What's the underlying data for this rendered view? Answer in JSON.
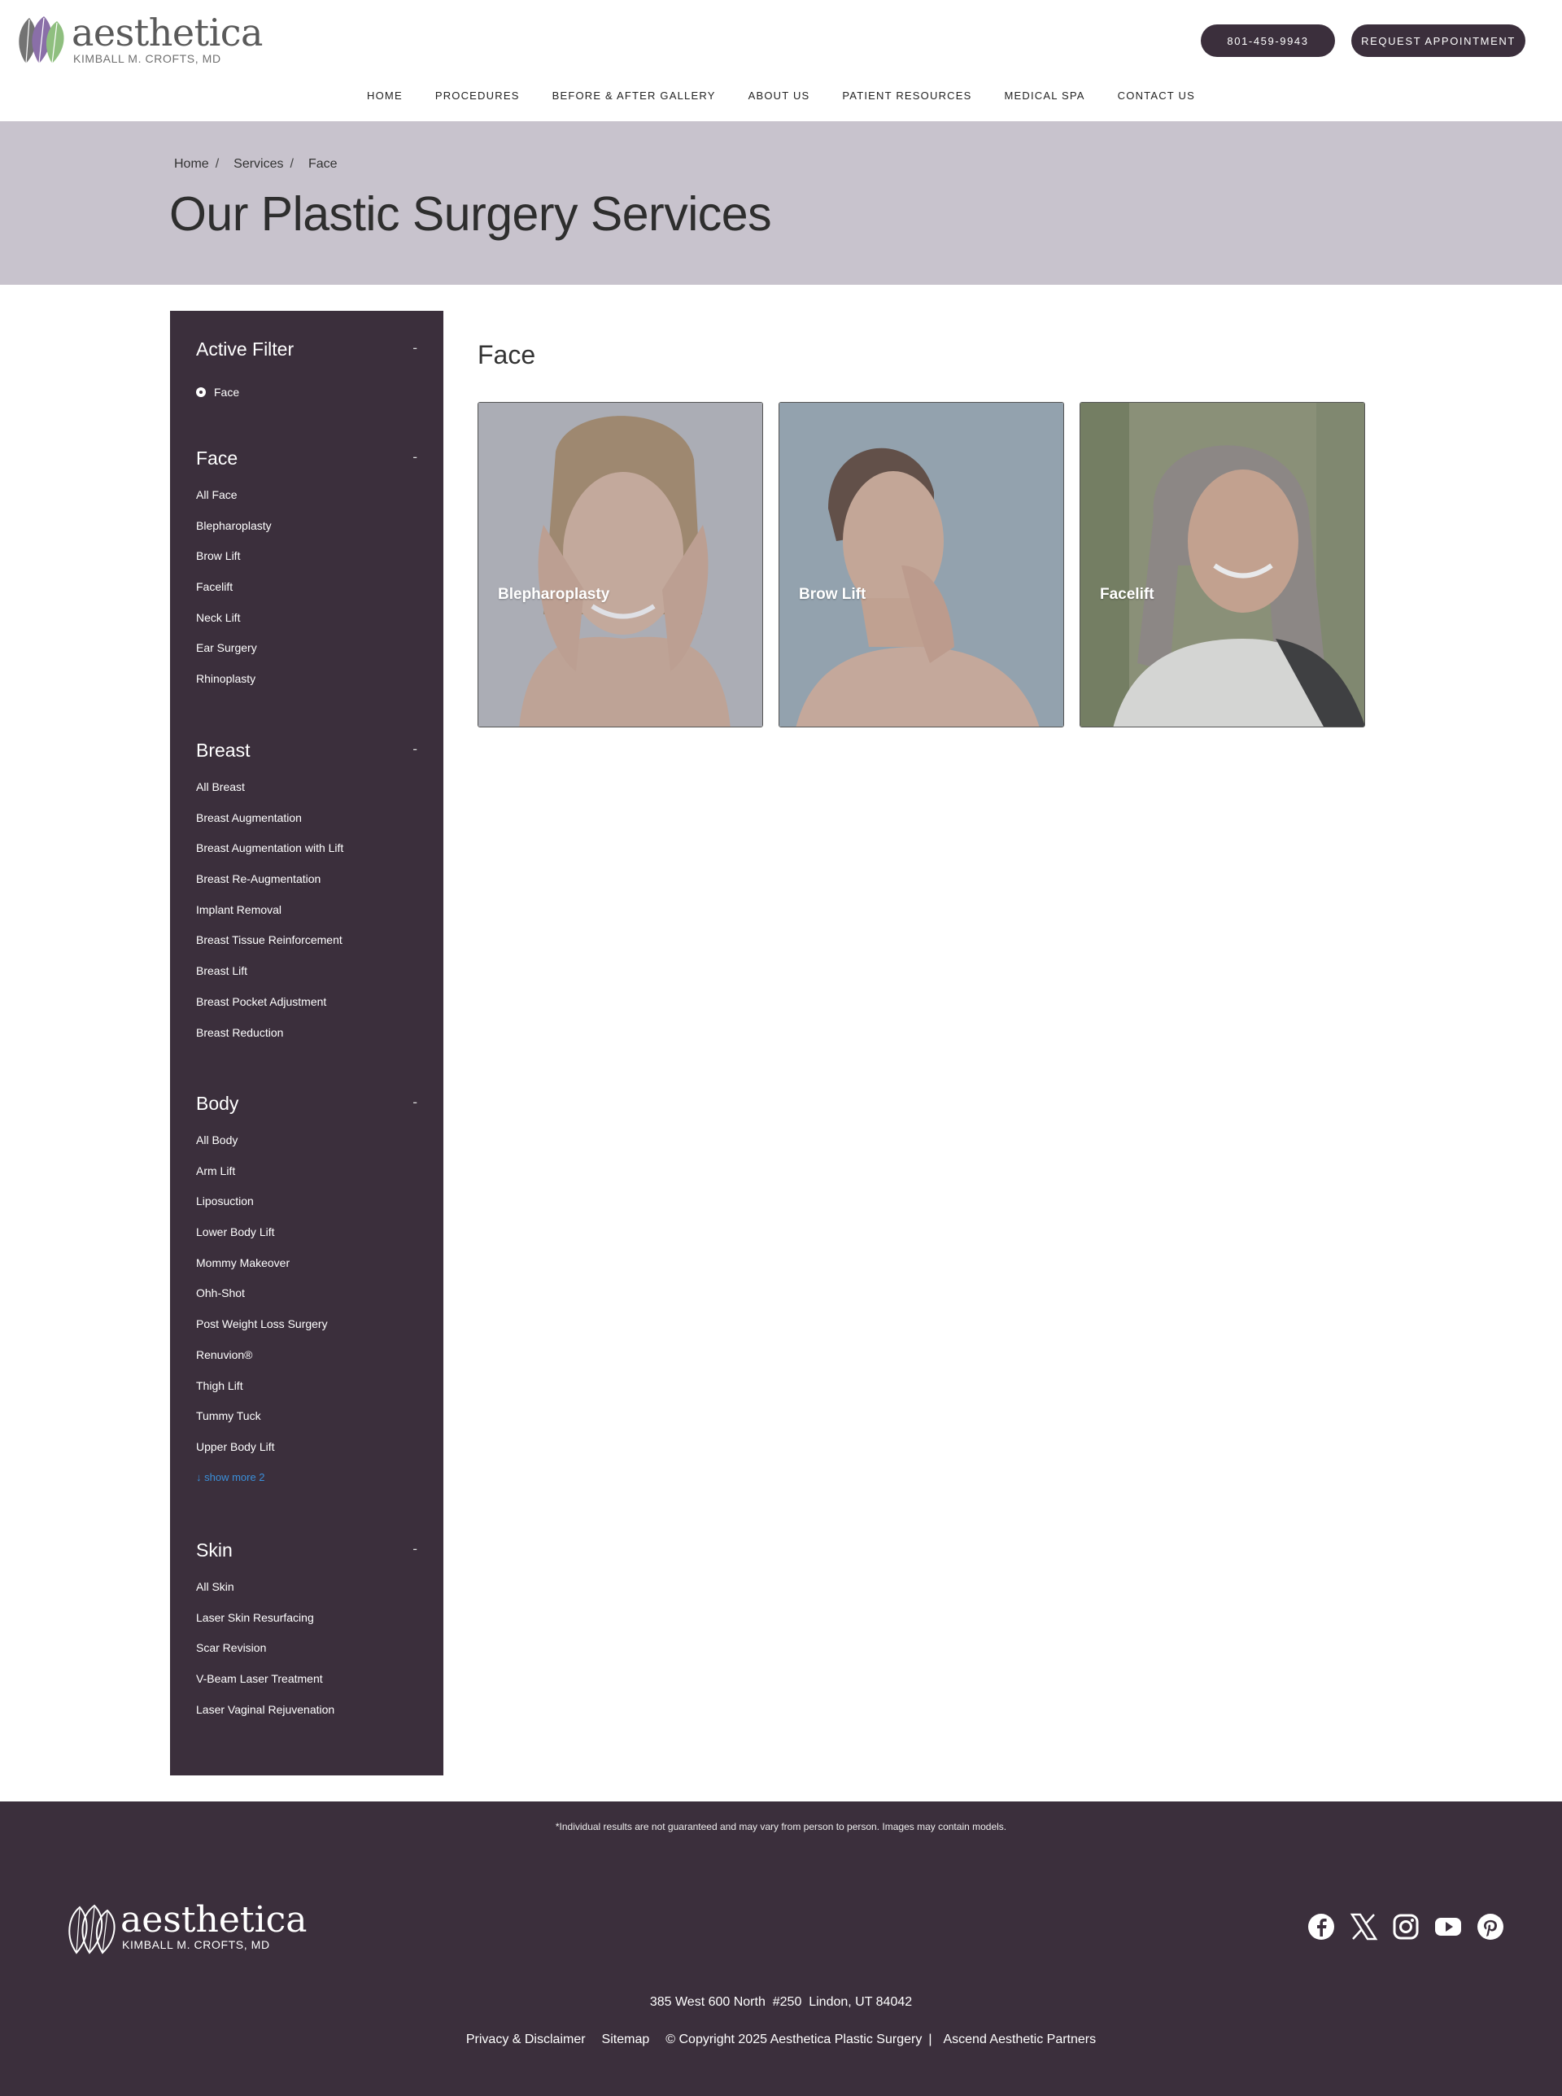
{
  "header": {
    "logo_word": "aesthetica",
    "logo_sub": "KIMBALL M. CROFTS, MD",
    "phone_label": "801-459-9943",
    "request_label": "REQUEST APPOINTMENT"
  },
  "nav": {
    "items": [
      {
        "label": "HOME"
      },
      {
        "label": "PROCEDURES"
      },
      {
        "label": "BEFORE & AFTER GALLERY"
      },
      {
        "label": "ABOUT US"
      },
      {
        "label": "PATIENT RESOURCES"
      },
      {
        "label": "MEDICAL SPA"
      },
      {
        "label": "CONTACT US"
      }
    ]
  },
  "hero": {
    "breadcrumb": [
      "Home",
      "Services",
      "Face"
    ],
    "breadcrumb_sep": "/",
    "title": "Our Plastic Surgery Services"
  },
  "sidebar": {
    "toggle_symbol": "-",
    "active_filter": {
      "title": "Active Filter",
      "value": "Face"
    },
    "sections": [
      {
        "title": "Face",
        "items": [
          "All Face",
          "Blepharoplasty",
          "Brow Lift",
          "Facelift",
          "Neck Lift",
          "Ear Surgery",
          "Rhinoplasty"
        ]
      },
      {
        "title": "Breast",
        "items": [
          "All Breast",
          "Breast Augmentation",
          "Breast Augmentation with Lift",
          "Breast Re-Augmentation",
          "Implant Removal",
          "Breast Tissue Reinforcement",
          "Breast Lift",
          "Breast Pocket Adjustment",
          "Breast Reduction"
        ]
      },
      {
        "title": "Body",
        "items": [
          "All Body",
          "Arm Lift",
          "Liposuction",
          "Lower Body Lift",
          "Mommy Makeover",
          "Ohh-Shot",
          "Post Weight Loss Surgery",
          "Renuvion®",
          "Thigh Lift",
          "Tummy Tuck",
          "Upper Body Lift"
        ],
        "show_more": "↓ show more 2"
      },
      {
        "title": "Skin",
        "items": [
          "All Skin",
          "Laser Skin Resurfacing",
          "Scar Revision",
          "V-Beam Laser Treatment",
          "Laser Vaginal Rejuvenation"
        ]
      }
    ]
  },
  "main": {
    "section_title": "Face",
    "cards": [
      {
        "label": "Blepharoplasty"
      },
      {
        "label": "Brow Lift"
      },
      {
        "label": "Facelift"
      }
    ]
  },
  "footer": {
    "disclaimer": "*Individual results are not guaranteed and may vary from person to person. Images may contain models.",
    "logo_word": "aesthetica",
    "logo_sub": "KIMBALL M. CROFTS, MD",
    "social_icons": [
      "facebook-icon",
      "x-icon",
      "instagram-icon",
      "youtube-icon",
      "pinterest-icon"
    ],
    "address": "385 West 600 North  #250  Lindon, UT 84042",
    "privacy": "Privacy & Disclaimer",
    "sitemap": "Sitemap",
    "copyright": "© Copyright 2025 Aesthetica Plastic Surgery",
    "divider": "|",
    "partner": "Ascend Aesthetic Partners"
  },
  "colors": {
    "brand_dark": "#3b2f3c",
    "hero_bg": "#c8c3cd",
    "leaf_purple": "#8a6fa8",
    "leaf_green": "#8fbf7f",
    "link_blue": "#3b8fd9"
  }
}
